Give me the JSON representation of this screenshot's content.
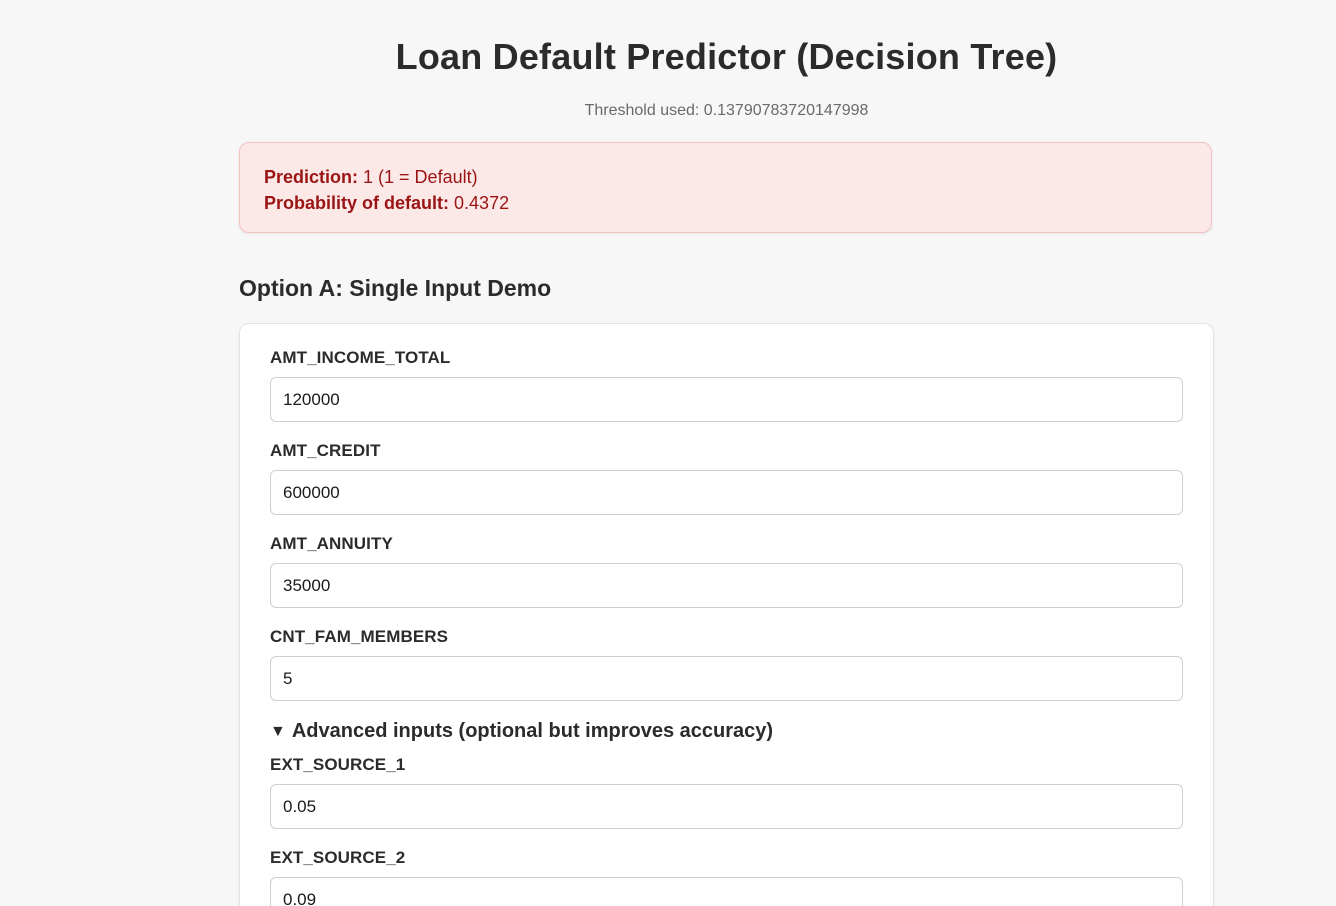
{
  "header": {
    "title": "Loan Default Predictor (Decision Tree)",
    "threshold_text": "Threshold used: 0.13790783720147998"
  },
  "result": {
    "prediction_label": "Prediction:",
    "prediction_value": "1 (1 = Default)",
    "probability_label": "Probability of default:",
    "probability_value": "0.4372"
  },
  "section": {
    "title": "Option A: Single Input Demo"
  },
  "form": {
    "amt_income_total": {
      "label": "AMT_INCOME_TOTAL",
      "value": "120000"
    },
    "amt_credit": {
      "label": "AMT_CREDIT",
      "value": "600000"
    },
    "amt_annuity": {
      "label": "AMT_ANNUITY",
      "value": "35000"
    },
    "cnt_fam_members": {
      "label": "CNT_FAM_MEMBERS",
      "value": "5"
    },
    "advanced": {
      "toggle_icon": "▼",
      "summary": "Advanced inputs (optional but improves accuracy)",
      "ext_source_1": {
        "label": "EXT_SOURCE_1",
        "value": "0.05"
      },
      "ext_source_2": {
        "label": "EXT_SOURCE_2",
        "value": "0.09"
      }
    }
  },
  "colors": {
    "background": "#f7f7f7",
    "alert_background": "#fde8e8",
    "alert_text": "#9b1414"
  }
}
